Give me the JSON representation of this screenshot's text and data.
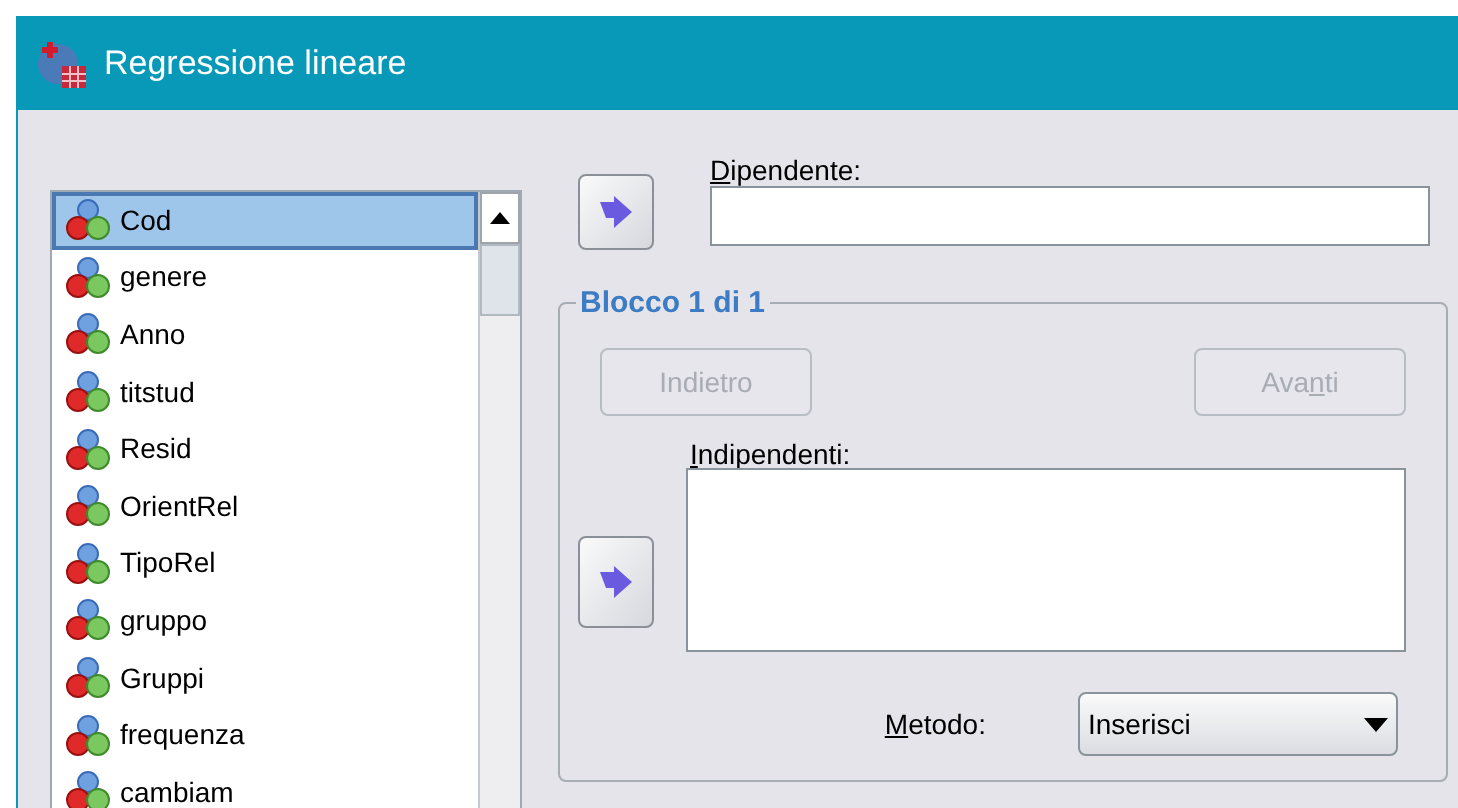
{
  "window": {
    "title": "Regressione lineare"
  },
  "variables": [
    {
      "name": "Cod",
      "selected": true
    },
    {
      "name": "genere",
      "selected": false
    },
    {
      "name": "Anno",
      "selected": false
    },
    {
      "name": "titstud",
      "selected": false
    },
    {
      "name": "Resid",
      "selected": false
    },
    {
      "name": "OrientRel",
      "selected": false
    },
    {
      "name": "TipoRel",
      "selected": false
    },
    {
      "name": "gruppo",
      "selected": false
    },
    {
      "name": "Gruppi",
      "selected": false
    },
    {
      "name": "frequenza",
      "selected": false
    },
    {
      "name": "cambiam",
      "selected": false
    }
  ],
  "dependent": {
    "label": {
      "key": "D",
      "post": "ipendente:"
    }
  },
  "block": {
    "title": "Blocco 1 di 1",
    "back": {
      "label": {
        "pre": "Indietro"
      },
      "disabled": true
    },
    "next": {
      "label": {
        "pre": "Ava",
        "key": "n",
        "post": "ti"
      },
      "disabled": true
    },
    "independents": {
      "label": {
        "key": "I",
        "post": "ndipendenti:"
      }
    },
    "method": {
      "label": {
        "key": "M",
        "post": "etodo:"
      },
      "value": "Inserisci"
    }
  }
}
